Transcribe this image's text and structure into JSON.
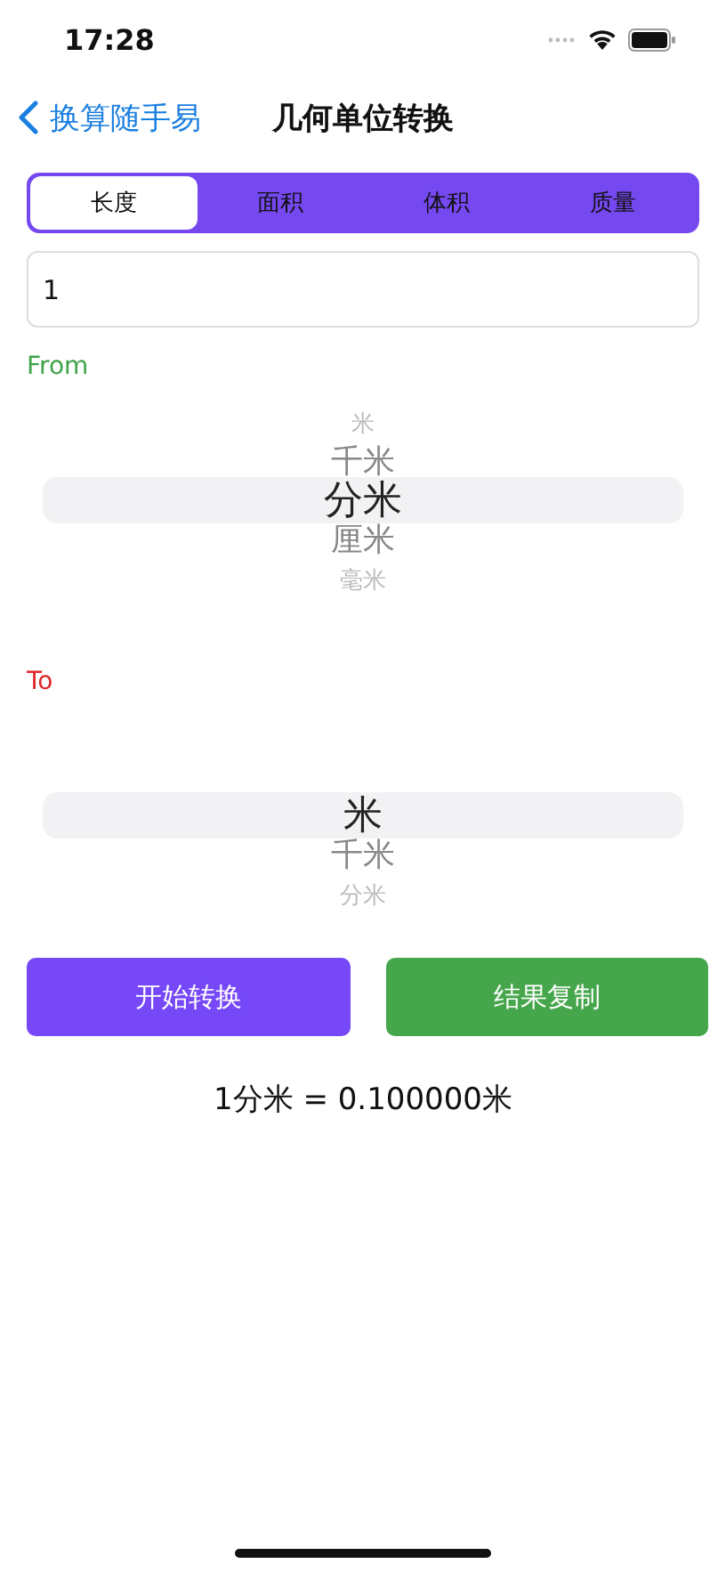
{
  "status_bar": {
    "time": "17:28"
  },
  "nav": {
    "back_label": "换算随手易",
    "title": "几何单位转换"
  },
  "tabs": [
    {
      "label": "长度",
      "selected": true
    },
    {
      "label": "面积",
      "selected": false
    },
    {
      "label": "体积",
      "selected": false
    },
    {
      "label": "质量",
      "selected": false
    }
  ],
  "input": {
    "value": "1"
  },
  "from": {
    "label": "From",
    "items": [
      {
        "label": "米",
        "selected": false
      },
      {
        "label": "千米",
        "selected": false
      },
      {
        "label": "分米",
        "selected": true
      },
      {
        "label": "厘米",
        "selected": false
      },
      {
        "label": "毫米",
        "selected": false
      }
    ]
  },
  "to": {
    "label": "To",
    "items": [
      {
        "label": "米",
        "selected": true
      },
      {
        "label": "千米",
        "selected": false
      },
      {
        "label": "分米",
        "selected": false
      }
    ]
  },
  "buttons": [
    {
      "label": "开始转换",
      "kind": "convert"
    },
    {
      "label": "结果复制",
      "kind": "copy"
    }
  ],
  "result": "1分米 = 0.100000米"
}
